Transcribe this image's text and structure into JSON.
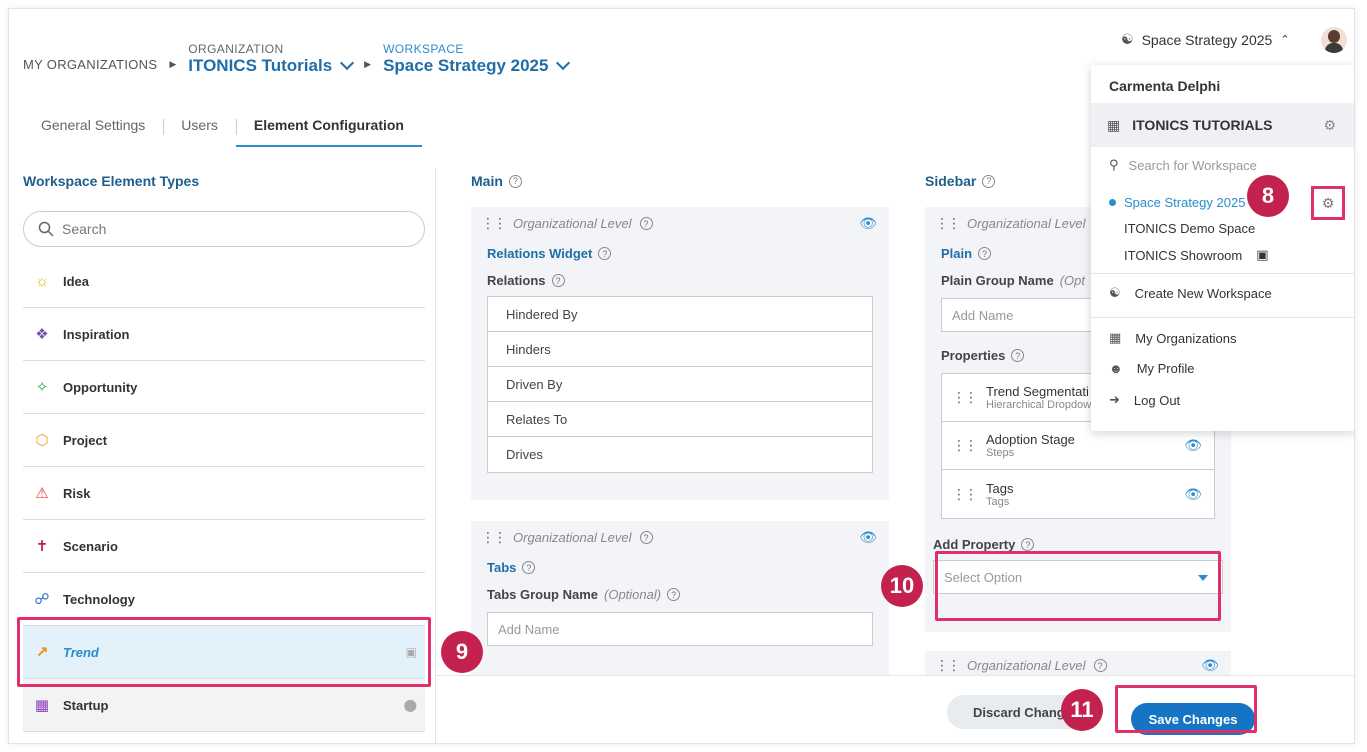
{
  "breadcrumb": {
    "root": "MY ORGANIZATIONS",
    "org_label": "ORGANIZATION",
    "org_value": "ITONICS Tutorials",
    "ws_label": "WORKSPACE",
    "ws_value": "Space Strategy 2025"
  },
  "tabs": [
    "General Settings",
    "Users",
    "Element Configuration"
  ],
  "left": {
    "title": "Workspace Element Types",
    "search_placeholder": "Search",
    "items": [
      {
        "label": "Idea",
        "icon": "lightbulb-icon",
        "color": "#e3b100"
      },
      {
        "label": "Inspiration",
        "icon": "brain-icon",
        "color": "#7a4fb0"
      },
      {
        "label": "Opportunity",
        "icon": "network-icon",
        "color": "#2aa84a"
      },
      {
        "label": "Project",
        "icon": "hexagon-icon",
        "color": "#f0a020"
      },
      {
        "label": "Risk",
        "icon": "alarm-icon",
        "color": "#e23a3a"
      },
      {
        "label": "Scenario",
        "icon": "signpost-icon",
        "color": "#c2185b"
      },
      {
        "label": "Technology",
        "icon": "molecule-icon",
        "color": "#2a6cc4"
      },
      {
        "label": "Trend",
        "icon": "trend-up-icon",
        "color": "#f08a1c"
      },
      {
        "label": "Startup",
        "icon": "building-icon",
        "color": "#8e3ab8"
      }
    ]
  },
  "main": {
    "title": "Main",
    "card1": {
      "level": "Organizational Level",
      "widget": "Relations Widget",
      "field": "Relations",
      "relations": [
        "Hindered By",
        "Hinders",
        "Driven By",
        "Relates To",
        "Drives"
      ]
    },
    "card2": {
      "level": "Organizational Level",
      "widget": "Tabs",
      "field": "Tabs Group Name",
      "optional": "(Optional)",
      "placeholder": "Add Name"
    }
  },
  "sidebar": {
    "title": "Sidebar",
    "card1": {
      "level": "Organizational Level",
      "widget": "Plain",
      "field": "Plain Group Name",
      "optional": "(Opt",
      "placeholder": "Add Name",
      "properties_label": "Properties",
      "properties": [
        {
          "name": "Trend Segmentati",
          "type": "Hierarchical Dropdown"
        },
        {
          "name": "Adoption Stage",
          "type": "Steps"
        },
        {
          "name": "Tags",
          "type": "Tags"
        }
      ],
      "add_property": "Add Property",
      "select_placeholder": "Select Option"
    },
    "card2_level": "Organizational Level"
  },
  "footer": {
    "discard": "Discard Changes",
    "save": "Save Changes"
  },
  "topbar": {
    "workspace": "Space Strategy 2025"
  },
  "menu": {
    "user": "Carmenta Delphi",
    "org": "ITONICS TUTORIALS",
    "search_placeholder": "Search for Workspace",
    "workspaces": [
      "Space Strategy 2025",
      "ITONICS Demo Space",
      "ITONICS Showroom"
    ],
    "create": "Create New Workspace",
    "links": [
      "My Organizations",
      "My Profile",
      "Log Out"
    ]
  },
  "callouts": [
    "8",
    "9",
    "10",
    "11"
  ],
  "colors": {
    "accent": "#2a8ccc",
    "highlight": "#e0306a",
    "badge": "#c3224f",
    "save": "#1574c4"
  }
}
